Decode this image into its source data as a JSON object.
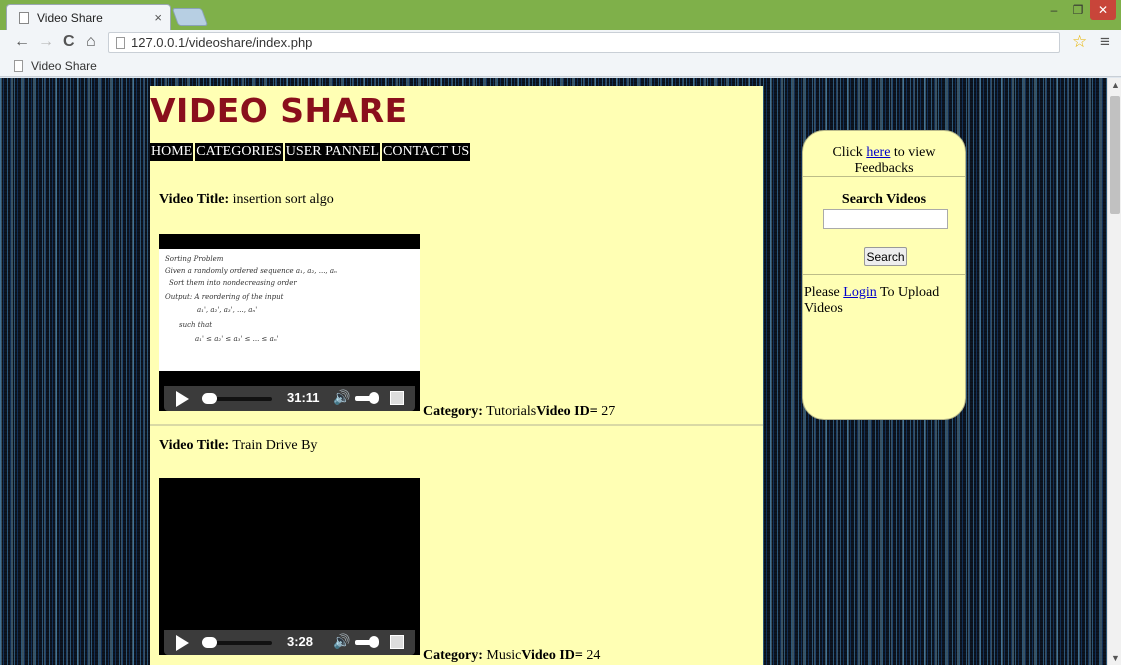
{
  "browser": {
    "tab_title": "Video Share",
    "tab_close": "×",
    "url": "127.0.0.1/videoshare/index.php",
    "bookmark": "Video Share",
    "win_min": "–",
    "win_max": "❐",
    "win_close": "✕",
    "icons": {
      "back": "←",
      "forward": "→",
      "reload": "C",
      "home": "⌂",
      "star": "☆",
      "menu": "≡"
    }
  },
  "site": {
    "title": "VIDEO SHARE",
    "nav": [
      "HOME",
      "CATEGORIES",
      "USER PANNEL",
      "CONTACT US"
    ]
  },
  "videos": [
    {
      "title_label": "Video Title:",
      "title": " insertion sort algo",
      "time": "31:11",
      "category_label": "Category:",
      "category": " Tutorials",
      "id_label": "Video ID=",
      "id": " 27",
      "screen_lines": [
        "Sorting Problem",
        "Given a randomly ordered sequence   a₁, a₂, ..., aₙ",
        "Sort them into nondecreasing order",
        "Output: A reordering of the input",
        "a₁', a₂', a₃', ..., aₙ'",
        "such that",
        "a₁' ≤ a₂' ≤ a₃' ≤ ... ≤ aₙ'"
      ]
    },
    {
      "title_label": "Video Title:",
      "title": " Train Drive By",
      "time": "3:28",
      "category_label": "Category:",
      "category": " Music",
      "id_label": "Video ID=",
      "id": " 24"
    }
  ],
  "sidebar": {
    "feedback_pre": "Click ",
    "feedback_link": "here",
    "feedback_post": " to view Feedbacks",
    "search_heading": "Search Videos",
    "search_value": "",
    "search_button": "Search",
    "login_pre": "Please ",
    "login_link": "Login",
    "login_post": " To Upload Videos"
  }
}
